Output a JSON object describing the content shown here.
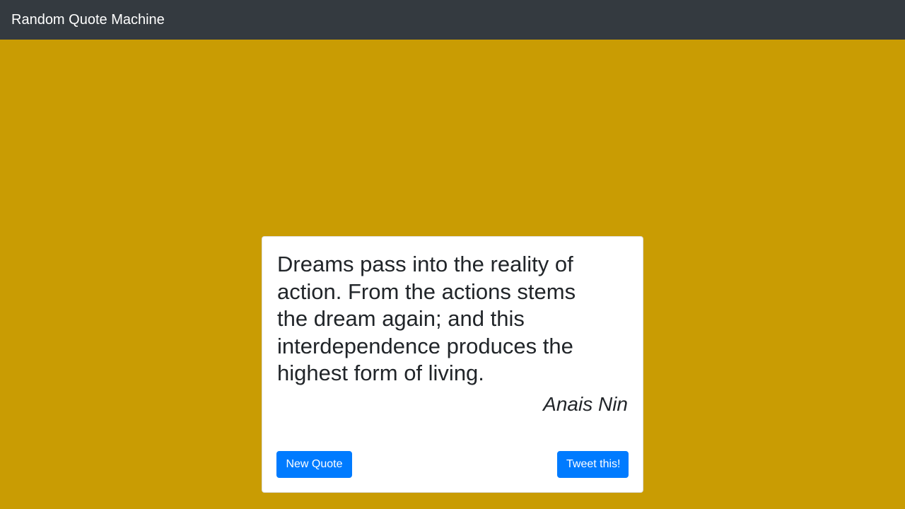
{
  "navbar": {
    "brand": "Random Quote Machine"
  },
  "quote": {
    "text": "Dreams pass into the reality of action. From the actions stems the dream again; and this interdependence produces the highest form of living.",
    "author": "Anais Nin"
  },
  "actions": {
    "new_quote_label": "New Quote",
    "tweet_label": "Tweet this!"
  },
  "colors": {
    "background": "#c99c03",
    "navbar": "#343a40",
    "button": "#007bff",
    "text": "#212529"
  }
}
